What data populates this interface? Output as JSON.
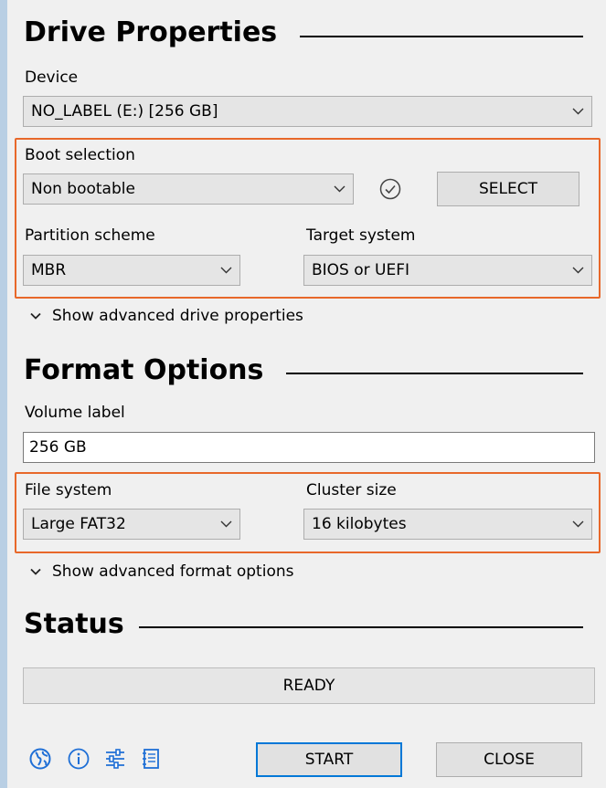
{
  "drive_properties": {
    "title": "Drive Properties",
    "device_label": "Device",
    "device_value": "NO_LABEL (E:) [256 GB]",
    "boot_selection_label": "Boot selection",
    "boot_selection_value": "Non bootable",
    "select_button": "SELECT",
    "partition_scheme_label": "Partition scheme",
    "partition_scheme_value": "MBR",
    "target_system_label": "Target system",
    "target_system_value": "BIOS or UEFI",
    "advanced_toggle": "Show advanced drive properties"
  },
  "format_options": {
    "title": "Format Options",
    "volume_label_label": "Volume label",
    "volume_label_value": "256 GB",
    "file_system_label": "File system",
    "file_system_value": "Large FAT32",
    "cluster_size_label": "Cluster size",
    "cluster_size_value": "16 kilobytes",
    "advanced_toggle": "Show advanced format options"
  },
  "status": {
    "title": "Status",
    "text": "READY"
  },
  "footer": {
    "start_button": "START",
    "close_button": "CLOSE",
    "icons": [
      "globe-icon",
      "info-icon",
      "settings-sliders-icon",
      "log-icon"
    ]
  },
  "colors": {
    "highlight_border": "#e8682a",
    "accent": "#0078d7",
    "icon_blue": "#1f6fd6"
  }
}
